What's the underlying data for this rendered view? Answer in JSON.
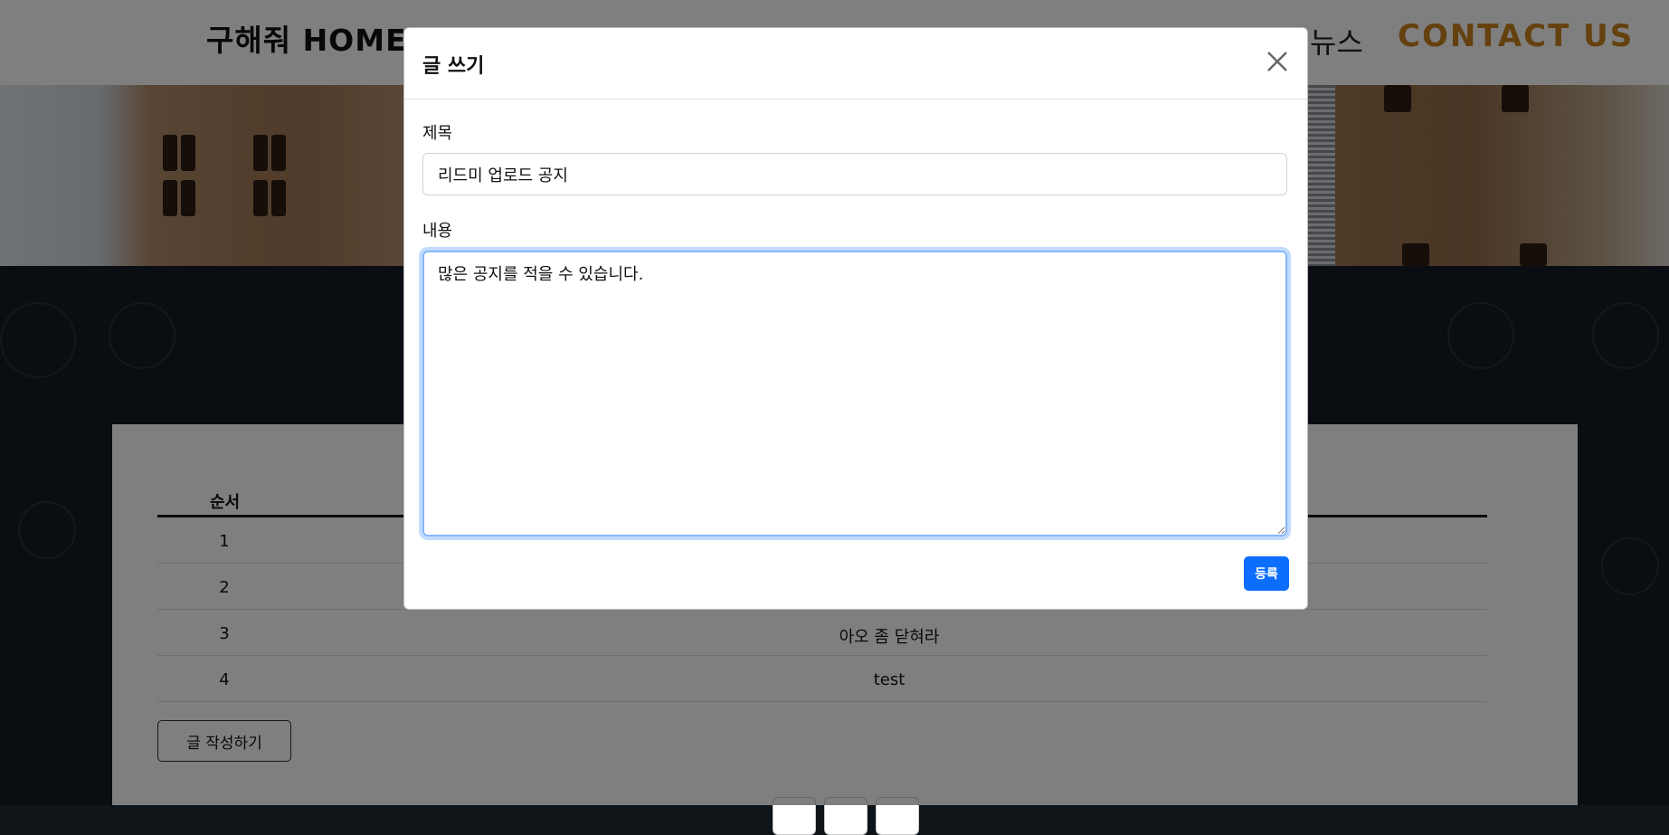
{
  "nav": {
    "brand": "구해줘 HOME!",
    "news": "뉴스",
    "contact": "CONTACT US"
  },
  "board": {
    "column_header": "순서",
    "rows": [
      {
        "num": "1",
        "title": ""
      },
      {
        "num": "2",
        "title": ""
      },
      {
        "num": "3",
        "title": "아오 좀 닫혀라"
      },
      {
        "num": "4",
        "title": "test"
      }
    ],
    "write_button": "글 작성하기"
  },
  "modal": {
    "title": "글 쓰기",
    "close_icon": "close-icon",
    "subject_label": "제목",
    "subject_value": "리드미 업로드 공지",
    "content_label": "내용",
    "content_value": "많은 공지를 적을 수 있습니다.",
    "submit_label": "등록"
  },
  "colors": {
    "accent": "#0d6efd",
    "contact": "#c8821c",
    "focus_ring": "#86b7fe"
  }
}
